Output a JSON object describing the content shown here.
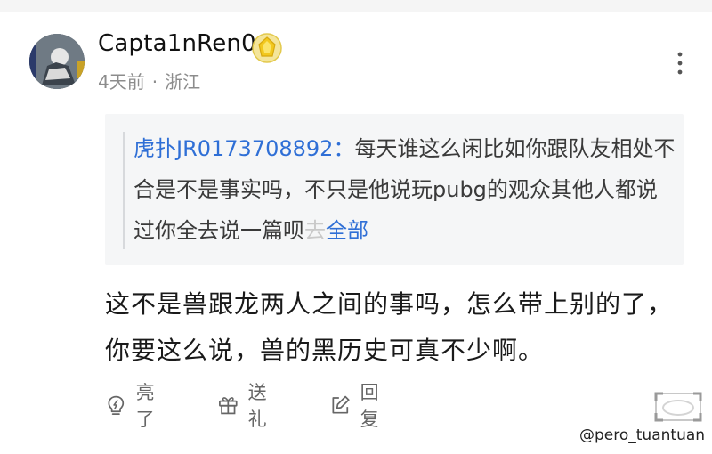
{
  "comment": {
    "username": "Capta1nRen0",
    "time": "4天前",
    "separator": "·",
    "location": "浙江",
    "quote": {
      "user": "虎扑JR0173708892：",
      "text": "每天谁这么闲比如你跟队友相处不合是不是事实吗，不只是他说玩pubg的观众其他人都说过你全去说一篇呗",
      "truncated_char": "去",
      "expand_label": "全部"
    },
    "body": "这不是兽跟龙两人之间的事吗，怎么带上别的了，你要这么说，兽的黑历史可真不少啊。",
    "actions": {
      "light_label": "亮了",
      "gift_label": "送礼",
      "reply_label": "回复"
    }
  },
  "watermark": "@pero_tuantuan",
  "colors": {
    "link": "#2f6fd6",
    "meta": "#8c8c8c",
    "quote_bg": "#f5f6f7"
  },
  "icons": {
    "badge": "yellow-gem-badge-icon",
    "more": "more-vertical-icon",
    "light": "lightbulb-icon",
    "gift": "gift-icon",
    "reply": "edit-reply-icon"
  }
}
